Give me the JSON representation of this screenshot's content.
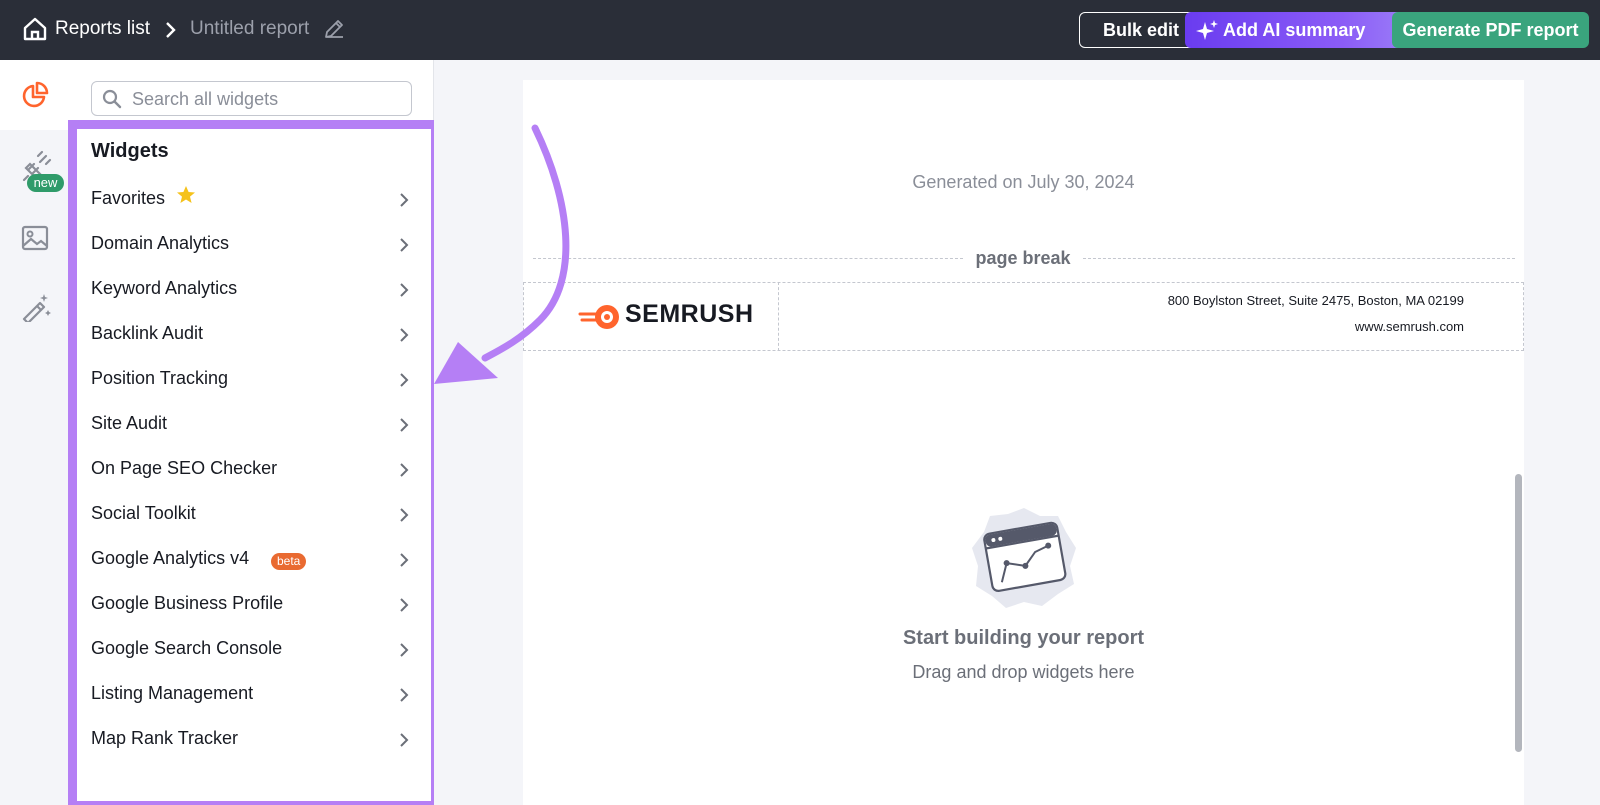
{
  "topbar": {
    "breadcrumb_root": "Reports list",
    "report_title": "Untitled report",
    "bulk_edit_label": "Bulk edit",
    "ai_summary_label": "Add AI summary",
    "generate_pdf_label": "Generate PDF report",
    "colors": {
      "bar": "#2a2e38",
      "ai_button": "#6a3cf0",
      "pdf_button": "#3aa47d"
    }
  },
  "rail": {
    "items": [
      {
        "icon": "pie-chart-icon",
        "active": true
      },
      {
        "icon": "plug-icon",
        "badge": "new"
      },
      {
        "icon": "image-icon"
      },
      {
        "icon": "magic-wand-icon"
      }
    ]
  },
  "widgets_panel": {
    "search_placeholder": "Search all widgets",
    "title": "Widgets",
    "items": [
      {
        "label": "Favorites",
        "icon": "star-icon"
      },
      {
        "label": "Domain Analytics"
      },
      {
        "label": "Keyword Analytics"
      },
      {
        "label": "Backlink Audit"
      },
      {
        "label": "Position Tracking"
      },
      {
        "label": "Site Audit"
      },
      {
        "label": "On Page SEO Checker"
      },
      {
        "label": "Social Toolkit"
      },
      {
        "label": "Google Analytics v4",
        "badge": "beta"
      },
      {
        "label": "Google Business Profile"
      },
      {
        "label": "Google Search Console"
      },
      {
        "label": "Listing Management"
      },
      {
        "label": "Map Rank Tracker"
      }
    ],
    "highlight_color": "#b57ff5"
  },
  "report": {
    "generated_text": "Generated on July 30, 2024",
    "page_break_label": "page break",
    "logo_text": "SEMRUSH",
    "address": "800 Boylston Street, Suite 2475, Boston, MA 02199",
    "website": "www.semrush.com",
    "empty_title": "Start building your report",
    "empty_subtitle": "Drag and drop widgets here",
    "brand_color": "#ff642d"
  }
}
